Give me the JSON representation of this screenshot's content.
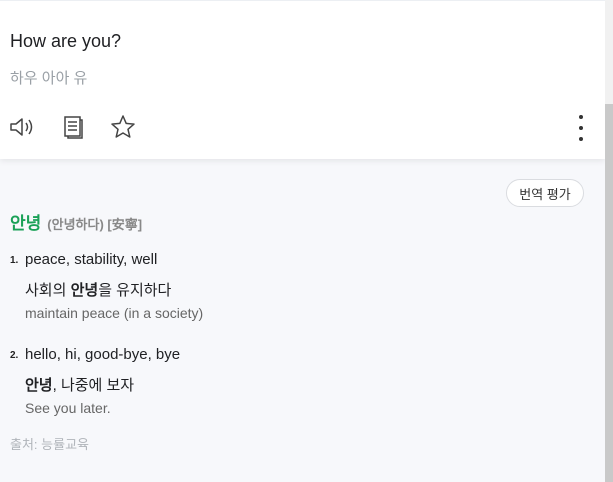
{
  "input": {
    "text": "How are you?",
    "pronunciation": "하우 아아 유"
  },
  "toolbar": {
    "icons": [
      "speaker-icon",
      "copy-icon",
      "star-icon",
      "more-vertical-icon"
    ]
  },
  "rate_button": {
    "label": "번역 평가"
  },
  "entry": {
    "headword": "안녕",
    "sub": "(안녕하다) [安寧]",
    "senses": [
      {
        "num": "1.",
        "meaning": "peace, stability, well",
        "example_ko_pre": "사회의 ",
        "example_ko_bold": "안녕",
        "example_ko_post": "을 유지하다",
        "example_en": "maintain peace (in a society)"
      },
      {
        "num": "2.",
        "meaning": "hello, hi, good-bye, bye",
        "example_ko_pre": "",
        "example_ko_bold": "안녕",
        "example_ko_post": ", 나중에 보자",
        "example_en": "See you later."
      }
    ]
  },
  "source_note": "출처: 능률교육",
  "colors": {
    "accent_green": "#1aa157",
    "muted": "#9aa0a6"
  }
}
